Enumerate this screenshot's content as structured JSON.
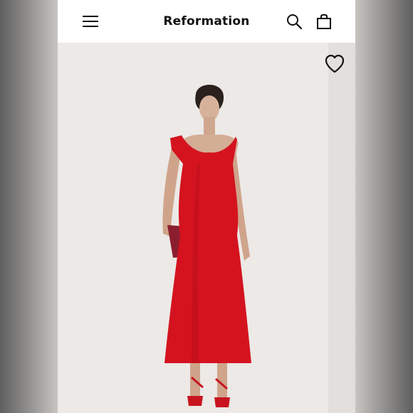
{
  "header": {
    "brand": "Reformation",
    "menu_icon": "hamburger-menu-icon",
    "search_icon": "search-icon",
    "bag_icon": "shopping-bag-icon"
  },
  "product_image": {
    "favorite_icon": "heart-icon",
    "dress_color": "#d4131f",
    "background_color": "#ece9e6"
  },
  "colors": {
    "topbar": "#ffffff",
    "text": "#111111"
  }
}
